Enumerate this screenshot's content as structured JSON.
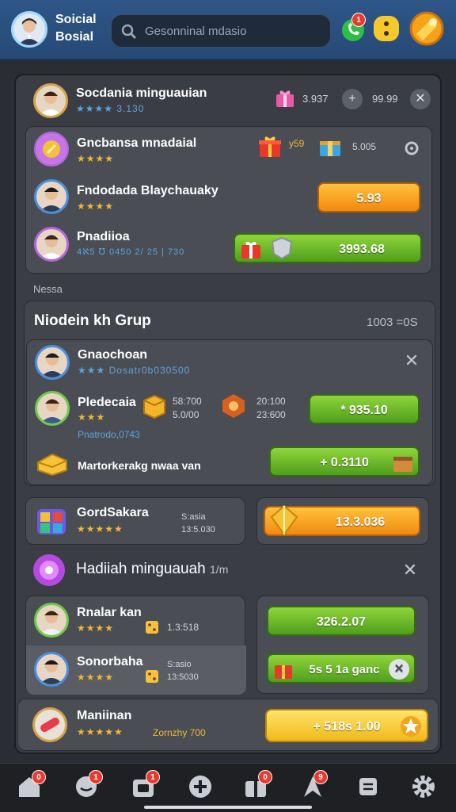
{
  "app": {
    "title": "Soicial Bosial"
  },
  "search": {
    "placeholder": "Gesonninal mdasio"
  },
  "topbar": {
    "badge1": "1"
  },
  "rows": {
    "r1": {
      "name": "Socdania minguauian",
      "sub": "★★★★ 3.130",
      "val1": "3.937",
      "val2": "99.99"
    },
    "r2": {
      "name": "Gncbansa mnadaial",
      "sub": "★★★★",
      "val1": "y59",
      "val2": "5.005"
    },
    "r3": {
      "name": "Fndodada Blaychauaky",
      "sub": "★★★★",
      "btn": "5.93"
    },
    "r4": {
      "name": "Pnadiioa",
      "sub": "4ℵ5 ℧ 0450 2/ 25 | 730",
      "btn": "3993.68"
    }
  },
  "sections": {
    "nessa": "Nessa",
    "group_title": "Niodein kh Grup",
    "group_count": "1003 =0S"
  },
  "group": {
    "g1": {
      "name": "Gnaochoan",
      "sub": "★★★ Dosatr0b030500"
    },
    "g2": {
      "name": "Pledecaia",
      "sub": "★★★",
      "a1": "58:700",
      "a2": "5.0/00",
      "b1": "20:100",
      "b2": "23:600",
      "btn": "* 935.10",
      "foot": "Pnatrodo,0743"
    },
    "g3": {
      "name": "Martorkerakg nwaa van",
      "btn": "+ 0.3110"
    }
  },
  "tiles": {
    "t1": {
      "name": "GordSakara",
      "sub": "★★★★★",
      "a": "S:asia",
      "b": "13:5.030"
    },
    "t1btn": "13.3.036"
  },
  "hadiah": {
    "title": "Hadiiah minguauah",
    "suffix": "1/m"
  },
  "players": {
    "p1": {
      "name": "Rnalar kan",
      "sub": "★★★★",
      "val": "1.3:518",
      "btn": "326.2.07"
    },
    "p2": {
      "name": "Sonorbaha",
      "sub": "★★★★",
      "a": "S:asio",
      "b": "13:5030",
      "btn": "5s 5 1a ganc"
    }
  },
  "bottom": {
    "name": "Maniinan",
    "sub": "★★★★★",
    "extra": "Zornzhy 700",
    "btn": "+ 518s 1.00"
  },
  "nav": {
    "b1": "0",
    "b2": "1",
    "b3": "1",
    "b4": "0",
    "b5": "9"
  }
}
